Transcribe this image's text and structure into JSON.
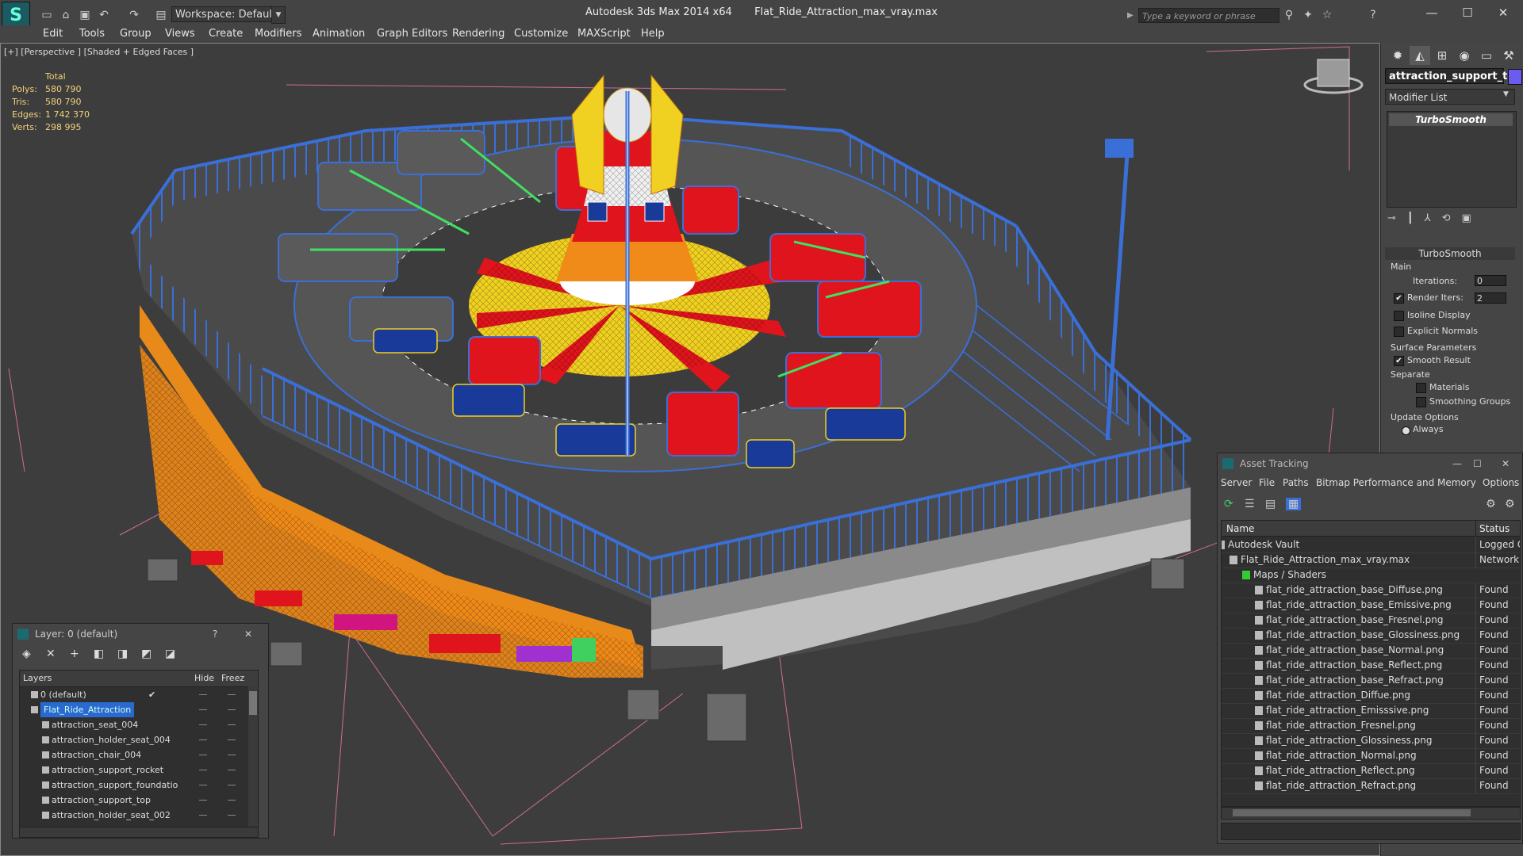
{
  "titlebar": {
    "workspace": "Workspace: Default",
    "app_name": "Autodesk 3ds Max  2014 x64",
    "file_name": "Flat_Ride_Attraction_max_vray.max",
    "search_placeholder": "Type a keyword or phrase"
  },
  "menu": [
    "Edit",
    "Tools",
    "Group",
    "Views",
    "Create",
    "Modifiers",
    "Animation",
    "Graph Editors",
    "Rendering",
    "Customize",
    "MAXScript",
    "Help"
  ],
  "viewport": {
    "label": "[+] [Perspective ] [Shaded + Edged Faces ]",
    "stats": {
      "header": "Total",
      "polys_label": "Polys:",
      "polys": "580 790",
      "tris_label": "Tris:",
      "tris": "580 790",
      "edges_label": "Edges:",
      "edges": "1 742 370",
      "verts_label": "Verts:",
      "verts": "298 995"
    },
    "colors": {
      "fence": "#3a6fd8",
      "red": "#e0141c",
      "yellow": "#f0d020",
      "orange": "#f08a18",
      "white": "#ffffff",
      "green": "#40e060"
    }
  },
  "command_panel": {
    "object_name": "attraction_support_top",
    "object_color": "#6b5cf0",
    "modifier_list": "Modifier List",
    "stack_item": "TurboSmooth",
    "rollout_title": "TurboSmooth",
    "main_group": "Main",
    "iterations_label": "Iterations:",
    "iterations": "0",
    "render_iters_label": "Render Iters:",
    "render_iters": "2",
    "isoline": "Isoline Display",
    "explicit": "Explicit Normals",
    "surface_group": "Surface Parameters",
    "smooth_result": "Smooth Result",
    "separate": "Separate",
    "materials": "Materials",
    "smoothing_groups": "Smoothing Groups",
    "update_group": "Update Options",
    "always": "Always"
  },
  "asset_tracking": {
    "title": "Asset Tracking",
    "menu": [
      "Server",
      "File",
      "Paths",
      "Bitmap Performance and Memory",
      "Options"
    ],
    "col_name": "Name",
    "col_status": "Status",
    "rows": [
      {
        "name": "Autodesk Vault",
        "status": "Logged O",
        "indent": 0
      },
      {
        "name": "Flat_Ride_Attraction_max_vray.max",
        "status": "Network P",
        "indent": 1
      },
      {
        "name": "Maps / Shaders",
        "status": "",
        "indent": 2
      },
      {
        "name": "flat_ride_attraction_base_Diffuse.png",
        "status": "Found",
        "indent": 3
      },
      {
        "name": "flat_ride_attraction_base_Emissive.png",
        "status": "Found",
        "indent": 3
      },
      {
        "name": "flat_ride_attraction_base_Fresnel.png",
        "status": "Found",
        "indent": 3
      },
      {
        "name": "flat_ride_attraction_base_Glossiness.png",
        "status": "Found",
        "indent": 3
      },
      {
        "name": "flat_ride_attraction_base_Normal.png",
        "status": "Found",
        "indent": 3
      },
      {
        "name": "flat_ride_attraction_base_Reflect.png",
        "status": "Found",
        "indent": 3
      },
      {
        "name": "flat_ride_attraction_base_Refract.png",
        "status": "Found",
        "indent": 3
      },
      {
        "name": "flat_ride_attraction_Diffue.png",
        "status": "Found",
        "indent": 3
      },
      {
        "name": "flat_ride_attraction_Emisssive.png",
        "status": "Found",
        "indent": 3
      },
      {
        "name": "flat_ride_attraction_Fresnel.png",
        "status": "Found",
        "indent": 3
      },
      {
        "name": "flat_ride_attraction_Glossiness.png",
        "status": "Found",
        "indent": 3
      },
      {
        "name": "flat_ride_attraction_Normal.png",
        "status": "Found",
        "indent": 3
      },
      {
        "name": "flat_ride_attraction_Reflect.png",
        "status": "Found",
        "indent": 3
      },
      {
        "name": "flat_ride_attraction_Refract.png",
        "status": "Found",
        "indent": 3
      }
    ]
  },
  "layer_panel": {
    "title": "Layer: 0 (default)",
    "help": "?",
    "col_layers": "Layers",
    "col_hide": "Hide",
    "col_freeze": "Freez",
    "rows": [
      {
        "name": "0 (default)",
        "indent": 1,
        "selected": false,
        "check": "✔"
      },
      {
        "name": "Flat_Ride_Attraction",
        "indent": 1,
        "selected": true,
        "check": ""
      },
      {
        "name": "attraction_seat_004",
        "indent": 2,
        "selected": false,
        "check": ""
      },
      {
        "name": "attraction_holder_seat_004",
        "indent": 2,
        "selected": false,
        "check": ""
      },
      {
        "name": "attraction_chair_004",
        "indent": 2,
        "selected": false,
        "check": ""
      },
      {
        "name": "attraction_support_rocket",
        "indent": 2,
        "selected": false,
        "check": ""
      },
      {
        "name": "attraction_support_foundatio",
        "indent": 2,
        "selected": false,
        "check": ""
      },
      {
        "name": "attraction_support_top",
        "indent": 2,
        "selected": false,
        "check": ""
      },
      {
        "name": "attraction_holder_seat_002",
        "indent": 2,
        "selected": false,
        "check": ""
      }
    ]
  }
}
